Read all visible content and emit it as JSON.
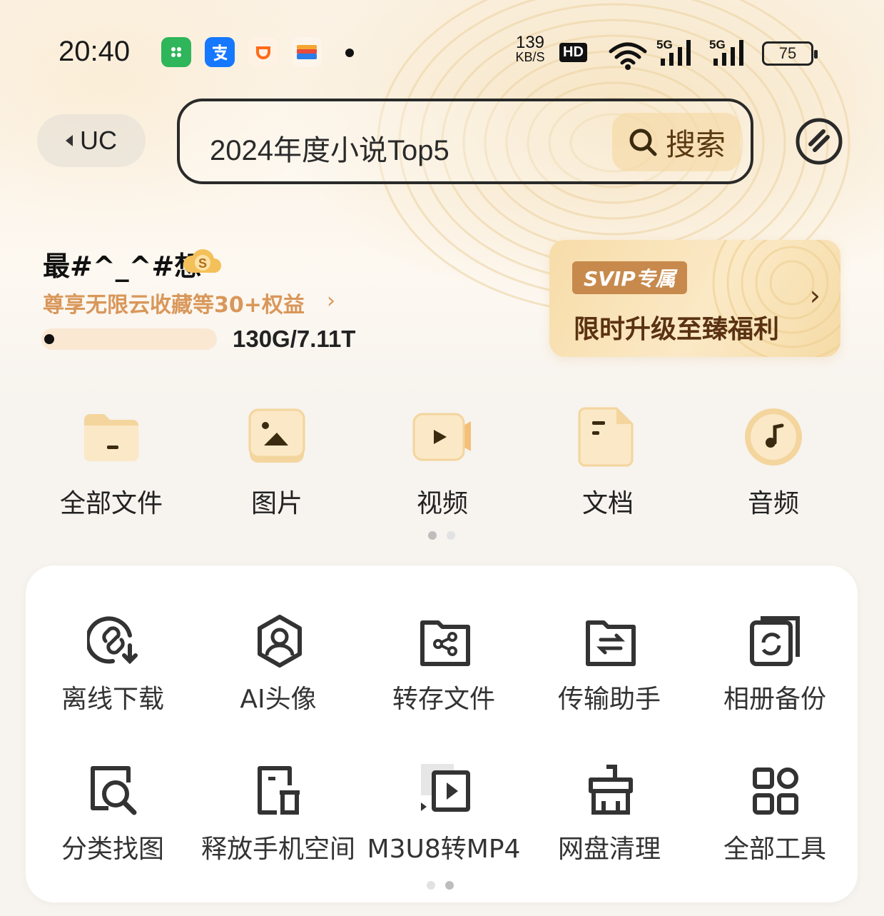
{
  "status_bar": {
    "time": "20:40",
    "notification_apps": [
      "wechat-mini-icon",
      "alipay-icon",
      "didi-icon",
      "wallet-icon"
    ],
    "net_speed_value": "139",
    "net_speed_unit": "KB/S",
    "hd_badge": "HD",
    "signal_labels": [
      "5G",
      "5G"
    ],
    "battery": "75"
  },
  "header": {
    "back_label": "UC",
    "search_text": "2024年度小说Top5",
    "search_button": "搜索"
  },
  "user": {
    "name": "最#^_^#想",
    "benefit_link": "尊享无限云收藏等30+权益",
    "storage_text": "130G/7.11T",
    "storage_fraction": 0.018
  },
  "svip_card": {
    "tag": "SVIP专属",
    "message": "限时升级至臻福利"
  },
  "categories": [
    {
      "label": "全部文件",
      "icon": "folder-icon"
    },
    {
      "label": "图片",
      "icon": "image-icon"
    },
    {
      "label": "视频",
      "icon": "video-icon"
    },
    {
      "label": "文档",
      "icon": "document-icon"
    },
    {
      "label": "音频",
      "icon": "audio-icon"
    }
  ],
  "tools": [
    {
      "label": "离线下载",
      "icon": "offline-download-icon"
    },
    {
      "label": "AI头像",
      "icon": "ai-avatar-icon"
    },
    {
      "label": "转存文件",
      "icon": "transfer-file-icon"
    },
    {
      "label": "传输助手",
      "icon": "transfer-assistant-icon"
    },
    {
      "label": "相册备份",
      "icon": "album-backup-icon"
    },
    {
      "label": "分类找图",
      "icon": "image-search-icon"
    },
    {
      "label": "释放手机空间",
      "icon": "free-space-icon"
    },
    {
      "label": "M3U8转MP4",
      "icon": "m3u8-convert-icon"
    },
    {
      "label": "网盘清理",
      "icon": "cleanup-icon"
    },
    {
      "label": "全部工具",
      "icon": "all-tools-icon"
    }
  ],
  "colors": {
    "accent_orange": "#d9975a",
    "svip_tag": "#c78a4c",
    "svip_text": "#5a3212",
    "icon_gold": "#f3d59d"
  }
}
